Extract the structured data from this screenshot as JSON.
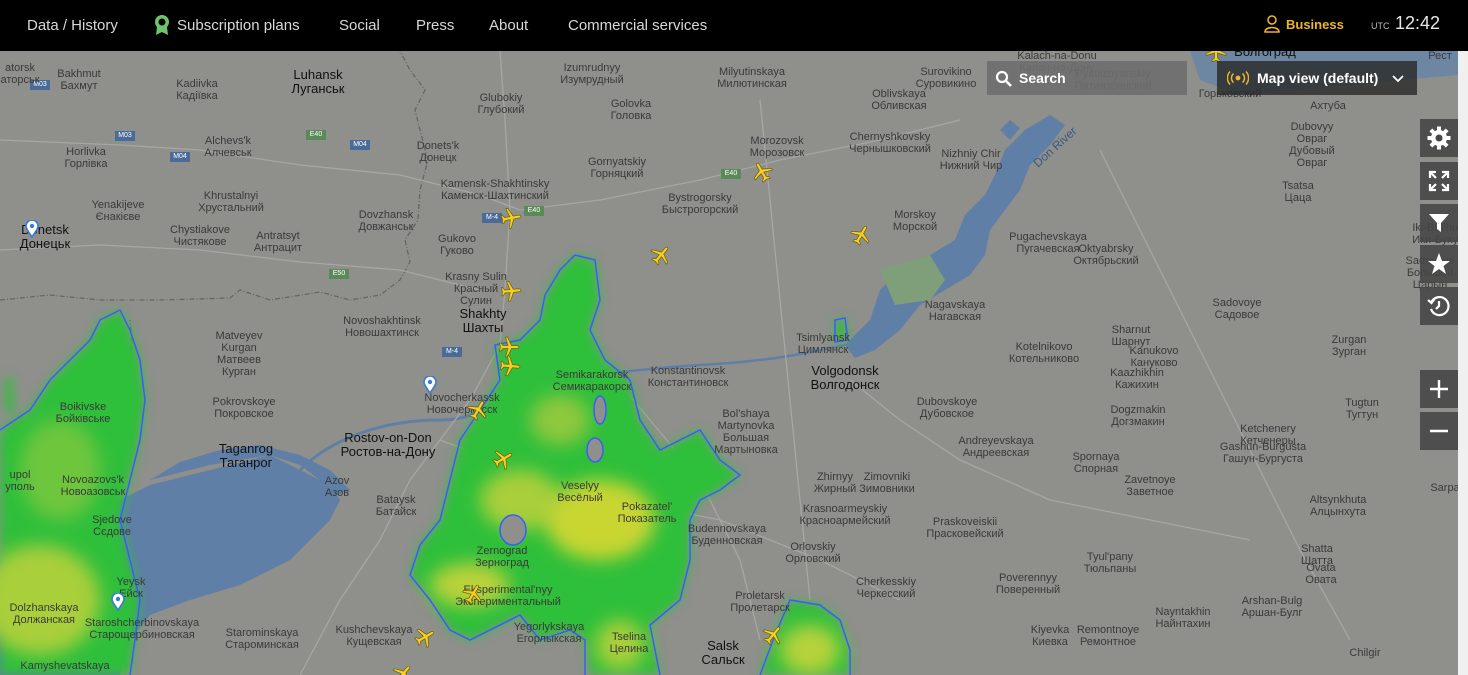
{
  "nav": {
    "items": [
      "Data / History",
      "Subscription plans",
      "Social",
      "Press",
      "About",
      "Commercial services"
    ],
    "business": "Business",
    "utc_label": "UTC",
    "time": "12:42"
  },
  "search": {
    "label": "Search"
  },
  "map_view": {
    "label": "Map view (default)"
  },
  "controls": [
    "settings-icon",
    "fullscreen-icon",
    "filter-icon",
    "star-icon",
    "playback-icon",
    "zoom-in-icon",
    "zoom-out-icon"
  ],
  "colors": {
    "aircraft": "#f5d020",
    "business_accent": "#f0b428",
    "precipitation_light": "#2fbf3a",
    "precipitation_moderate": "#c9d630",
    "water": "#5f7fa6"
  },
  "map_labels": {
    "luhansk": [
      "Luhansk",
      "Луганськ"
    ],
    "bakhmut": [
      "Bakhmut",
      "Бахмут"
    ],
    "kadiivka": [
      "Kadiivka",
      "Кадіївка"
    ],
    "torsk": [
      "atorsk",
      "аторськ"
    ],
    "horlivka": [
      "Horlivka",
      "Горлівка"
    ],
    "alchevsk": [
      "Alchevs'k",
      "Алчевськ"
    ],
    "khrustalnyi": [
      "Khrustalnyi",
      "Хрустальний"
    ],
    "yenakiieve": [
      "Yenakijeve",
      "Єнакієве"
    ],
    "donetsk": [
      "Donetsk",
      "Донецьк"
    ],
    "chystiakove": [
      "Chystiakove",
      "Чистякове"
    ],
    "antratsyt": [
      "Antratsyt",
      "Антрацит"
    ],
    "dovzhansk": [
      "Dovzhansk",
      "Довжанськ"
    ],
    "donetsk_ru": [
      "Donets'k",
      "Донецк"
    ],
    "kamensk": [
      "Kamensk-Shakhtinsky",
      "Каменск-Шахтинский"
    ],
    "gukovo": [
      "Gukovo",
      "Гуково"
    ],
    "krasny_sulin": [
      "Krasny Sulin",
      "Красный",
      "Сулин"
    ],
    "shakhty": [
      "Shakhty",
      "Шахты"
    ],
    "novoshakhtinsk": [
      "Novoshakhtinsk",
      "Новошахтинск"
    ],
    "novocherkassk": [
      "Novocherkassk",
      "Новочеркасск"
    ],
    "izumrudny": [
      "Izumrudnyy",
      "Изумрудный"
    ],
    "glubokiy": [
      "Glubokiy",
      "Глубокий"
    ],
    "golovka": [
      "Golovka",
      "Головка"
    ],
    "gornyatsky": [
      "Gornyatskiy",
      "Горняцкий"
    ],
    "milyutinskaya": [
      "Milyutinskaya",
      "Милютинская"
    ],
    "morozovsk": [
      "Morozovsk",
      "Морозовск"
    ],
    "bystrogorsky": [
      "Bystrogorsky",
      "Быстрогорский"
    ],
    "oblivskaya": [
      "Oblivskaya",
      "Обливская"
    ],
    "surovikino": [
      "Surovikino",
      "Суровикино"
    ],
    "chernyshkovsky": [
      "Chernyshkovsky",
      "Чернышковский"
    ],
    "nizhny_chir": [
      "Nizhniy Chir",
      "Нижний Чир"
    ],
    "morskoy": [
      "Morskoy",
      "Морской"
    ],
    "pyatiizbyansky": [
      "Pyatiizbyanskiy",
      "Пятиизбянский"
    ],
    "dubovyy": [
      "Dubovyy",
      "Овраг",
      "Дубовый",
      "Овраг"
    ],
    "tsatsa": [
      "Tsatsa",
      "Цаца"
    ],
    "pugachevskaya": [
      "Pugachevskaya",
      "Пугачевская"
    ],
    "oktyabrsky": [
      "Oktyabrsky",
      "Октябрьский"
    ],
    "ikibukhus": [
      "Iki-Bukhus",
      "Ики-Бухус"
    ],
    "nagavskaya": [
      "Nagavskaya",
      "Нагавская"
    ],
    "sadovoye": [
      "Sadovoye",
      "Садовое"
    ],
    "tsimlyansk": [
      "Tsimlyansk",
      "Цимлянск"
    ],
    "volgodonsk": [
      "Volgodonsk",
      "Волгодонск"
    ],
    "sharnut": [
      "Sharnut",
      "Шарнут"
    ],
    "kotelnikovo": [
      "Kotelnikovo",
      "Котельниково"
    ],
    "kanukovo": [
      "Kanukovo",
      "Кануково"
    ],
    "zurgan": [
      "Zurgan",
      "Зурган"
    ],
    "kaazhikhin": [
      "Kaazhikhin",
      "Кажихин"
    ],
    "tugtun": [
      "Tugtun",
      "Тугтун"
    ],
    "dogzmakin": [
      "Dogzmakin",
      "Догзмакин"
    ],
    "ketchenery": [
      "Ketchenery",
      "Кетченеры"
    ],
    "semikarakorsk": [
      "Semikarakorsk",
      "Семикаракорск"
    ],
    "konstantinovsk": [
      "Konstantinovsk",
      "Константиновск"
    ],
    "martynovka": [
      "Bol'shaya",
      "Martynovka",
      "Большая",
      "Мартыновка"
    ],
    "dubovskoye": [
      "Dubovskoye",
      "Дубовское"
    ],
    "andreyevskaya": [
      "Andreyevskaya",
      "Андреевская"
    ],
    "spornaya": [
      "Spornaya",
      "Спорная"
    ],
    "zavetnoye": [
      "Zavetnoye",
      "Заветное"
    ],
    "gashun": [
      "Gashun-Burgusta",
      "Гашун-Бургуста"
    ],
    "altsynkhuta": [
      "Altsynkhuta",
      "Алцынхута"
    ],
    "matveyev_kurgan": [
      "Matveyev",
      "Kurgan",
      "Матвеев",
      "Курган"
    ],
    "pokrovskoye": [
      "Pokrovskoye",
      "Покровское"
    ],
    "taganrog": [
      "Taganrog",
      "Таганрог"
    ],
    "rostov": [
      "Rostov-on-Don",
      "Ростов-на-Дону"
    ],
    "azov": [
      "Azov",
      "Азов"
    ],
    "bataysk": [
      "Bataysk",
      "Батайск"
    ],
    "novoazovsk": [
      "Novoazovs'k",
      "Новоазовськ"
    ],
    "sjedove": [
      "Sjedove",
      "Сєдове"
    ],
    "mariupol": [
      "upol",
      "уполь"
    ],
    "bolshevik": [
      "Boikivske",
      "Бойківське"
    ],
    "veselyy": [
      "Veselyy",
      "Весёлый"
    ],
    "pokazatel": [
      "Pokazatel'",
      "Показатель"
    ],
    "zhirnyy": [
      "Zhirnyy",
      "Жирный"
    ],
    "zimovniki": [
      "Zimovniki",
      "Зимовники"
    ],
    "krasnoarmeysky": [
      "Krasnoarmeyskiy",
      "Красноармейский"
    ],
    "praskoveisky": [
      "Praskoveiskii",
      "Прасковейский"
    ],
    "budennovskaya": [
      "Budennovskaya",
      "Буденновская"
    ],
    "orlovsky": [
      "Orlovskiy",
      "Орловский"
    ],
    "zernograd": [
      "Zernograd",
      "Зерноград"
    ],
    "eksperimentalny": [
      "Eksperimental'nyy",
      "Экспериментальный"
    ],
    "tyulpany": [
      "Tyul'pany",
      "Тюльпаны"
    ],
    "shatta": [
      "Shatta",
      "Шатта"
    ],
    "ovata": [
      "Ovata",
      "Овата"
    ],
    "cherkessky": [
      "Cherkesskiy",
      "Черкесский"
    ],
    "poverennyy": [
      "Poverennyy",
      "Поверенный"
    ],
    "arshan": [
      "Arshan-Bulg",
      "Аршан-Булг"
    ],
    "proletarsk": [
      "Proletarsk",
      "Пролетарск"
    ],
    "salsk": [
      "Salsk",
      "Сальск"
    ],
    "tselina": [
      "Tselina",
      "Целина"
    ],
    "yegorlykskaya": [
      "Yegorlykskaya",
      "Егорлыкская"
    ],
    "kushchevskaya": [
      "Kushchevskaya",
      "Кущевская"
    ],
    "starominskaya": [
      "Starominskaya",
      "Староминская"
    ],
    "yeysk": [
      "Yeysk",
      "Ейск"
    ],
    "dolzhanskaya": [
      "Dolzhanskaya",
      "Должанская"
    ],
    "staroshcherb": [
      "Staroshcherbinovskaya",
      "Старощербиновская"
    ],
    "kamyshevatskaya": [
      "Kamyshevatskaya"
    ],
    "kiyevka": [
      "Kiyevka",
      "Киевка"
    ],
    "remontnoye": [
      "Remontnoye",
      "Ремонтное"
    ],
    "nayntakhin": [
      "Nayntakhin",
      "Найнтахин"
    ],
    "chilgir": [
      "Chilgir"
    ],
    "sarpa": [
      "Sarpa"
    ],
    "kalach": [
      "Kalach-na-Donu",
      "Калач-на-Дону"
    ],
    "volgograd": [
      "Волгоград"
    ],
    "gorkovsky": [
      "Горьковский"
    ],
    "akhtuba": [
      "Ахтуба"
    ],
    "rest": [
      "Рест"
    ],
    "bolshoy": [
      "Sadovoye",
      "Большой",
      "Царын"
    ],
    "don_river": [
      "Don River"
    ],
    "hw_m03": [
      "M03"
    ],
    "hw_m04": [
      "M04"
    ],
    "hw_e40a": [
      "E40"
    ],
    "hw_m04b": [
      "M04"
    ],
    "hw_m4": [
      "M-4"
    ],
    "hw_e40b": [
      "E40"
    ],
    "hw_e50": [
      "E50"
    ],
    "hw_m4b": [
      "M-4"
    ],
    "hw_e40c": [
      "E40"
    ],
    "hw_m03b": [
      "M03"
    ]
  }
}
